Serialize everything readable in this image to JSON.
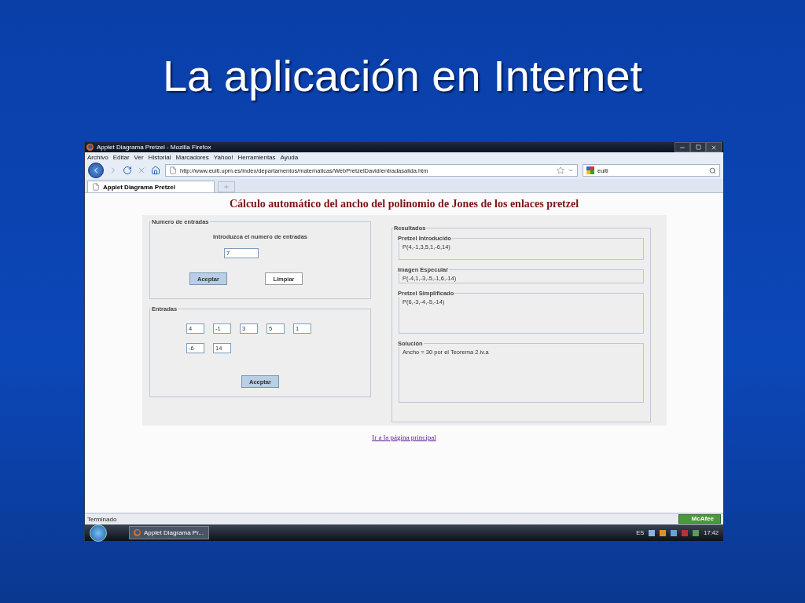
{
  "slide": {
    "title": "La aplicación en Internet"
  },
  "window": {
    "title": "Applet Diagrama Pretzel - Mozilla Firefox"
  },
  "menu": [
    "Archivo",
    "Editar",
    "Ver",
    "Historial",
    "Marcadores",
    "Yahoo!",
    "Herramientas",
    "Ayuda"
  ],
  "address_bar": {
    "url": "http://www.euiti.upm.es/index/departamentos/matematicas/WebPretzelDavid/entradasalida.htm"
  },
  "search_box": {
    "value": "euiti"
  },
  "tabs": [
    {
      "label": "Applet Diagrama Pretzel",
      "selected": true
    }
  ],
  "page": {
    "heading": "Cálculo automático del ancho del polinomio de Jones de los enlaces pretzel",
    "count_panel": {
      "legend": "Numero de entradas",
      "prompt": "Introduzca el numero de entradas",
      "value": "7",
      "buttons": [
        {
          "label": "Aceptar",
          "default": true
        },
        {
          "label": "Limpiar",
          "default": false
        }
      ]
    },
    "entries_panel": {
      "legend": "Entradas",
      "values": [
        "4",
        "-1",
        "3",
        "5",
        "1",
        "-6",
        "14"
      ],
      "button": {
        "label": "Aceptar",
        "default": true
      }
    },
    "results_panel": {
      "legend": "Resultados",
      "sections": [
        {
          "legend": "Pretzel Introducido",
          "value": "P(4,-1,3,5,1,-6,14)"
        },
        {
          "legend": "Imagen Especular",
          "value": "P(-4,1,-3,-5,-1,6,-14)"
        },
        {
          "legend": "Pretzel Simplificado",
          "value": "P(6,-3,-4,-5,-14)"
        },
        {
          "legend": "Solución",
          "value": "Ancho = 30 por el Teorema 2.iv.a"
        }
      ]
    },
    "link": "Ir a la página principal"
  },
  "status_bar": {
    "text": "Terminado",
    "addon": "McAfee"
  },
  "taskbar": {
    "task": "Applet Diagrama Pr...",
    "language": "ES",
    "clock": "17:42"
  }
}
